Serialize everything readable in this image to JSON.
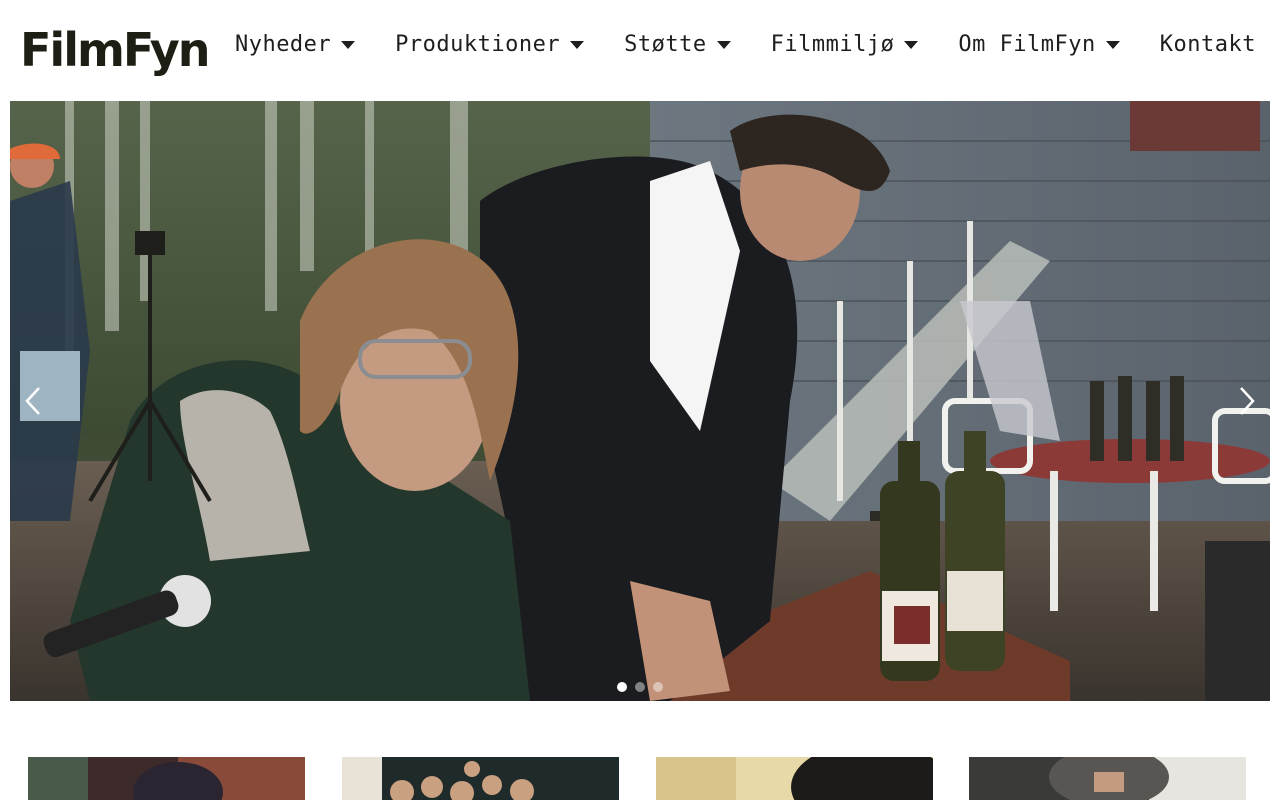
{
  "site": {
    "logo_text": "FilmFyn"
  },
  "nav": {
    "items": [
      {
        "label": "Nyheder",
        "has_dropdown": true
      },
      {
        "label": "Produktioner",
        "has_dropdown": true
      },
      {
        "label": "Støtte",
        "has_dropdown": true
      },
      {
        "label": "Filmmiljø",
        "has_dropdown": true
      },
      {
        "label": "Om FilmFyn",
        "has_dropdown": true
      },
      {
        "label": "Kontakt",
        "has_dropdown": false
      }
    ]
  },
  "hero": {
    "slide_count": 3,
    "active_slide": 1,
    "prev_icon": "chevron-left-icon",
    "next_icon": "chevron-right-icon"
  },
  "colors": {
    "logo": "#1e1f14",
    "nav_text": "#1e1e1e",
    "background": "#ffffff"
  }
}
